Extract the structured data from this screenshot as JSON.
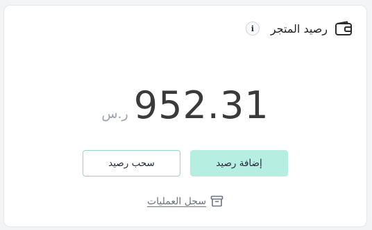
{
  "card": {
    "title": "رصيد المتجر",
    "title_icon": "wallet-icon",
    "info_icon_glyph": "i"
  },
  "balance": {
    "amount": "952.31",
    "currency": "ر.س"
  },
  "actions": {
    "add_balance_label": "إضافة رصيد",
    "withdraw_balance_label": "سحب رصيد"
  },
  "history": {
    "label": "سجل العمليات",
    "icon": "archive-icon"
  },
  "colors": {
    "primary_button_bg": "#b6efe2",
    "secondary_button_border": "#8fd9c7",
    "amount_text": "#3a3a3a",
    "muted_text": "#9ca3af"
  }
}
